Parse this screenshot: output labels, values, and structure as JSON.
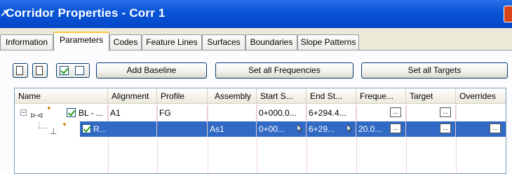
{
  "window": {
    "title_icon": "↗",
    "title": "Corridor Properties - Corr 1"
  },
  "tabs": [
    {
      "label": "Information"
    },
    {
      "label": "Parameters"
    },
    {
      "label": "Codes"
    },
    {
      "label": "Feature Lines"
    },
    {
      "label": "Surfaces"
    },
    {
      "label": "Boundaries"
    },
    {
      "label": "Slope Patterns"
    }
  ],
  "toolbar": {
    "add_baseline": "Add Baseline",
    "set_all_frequencies": "Set all Frequencies",
    "set_all_targets": "Set all Targets"
  },
  "grid": {
    "columns": [
      "Name",
      "Alignment",
      "Profile",
      "Assembly",
      "Start S...",
      "End St...",
      "Freque...",
      "Target",
      "Overrides"
    ],
    "rows": [
      {
        "name": "BL - ...",
        "alignment": "A1",
        "profile": "FG",
        "assembly": "",
        "start": "0+000.0...",
        "end": "6+294.4...",
        "frequency": "",
        "target": "",
        "overrides": ""
      },
      {
        "name": "R...",
        "alignment": "",
        "profile": "",
        "assembly": "As1",
        "start": "0+00...",
        "end": "6+29...",
        "frequency": "20.0...",
        "target": "",
        "overrides": ""
      }
    ],
    "ellipsis": "..."
  },
  "colors": {
    "title_bar": "#0a56d8",
    "selection": "#316ac5",
    "active_tab_accent": "#ffc83c"
  }
}
